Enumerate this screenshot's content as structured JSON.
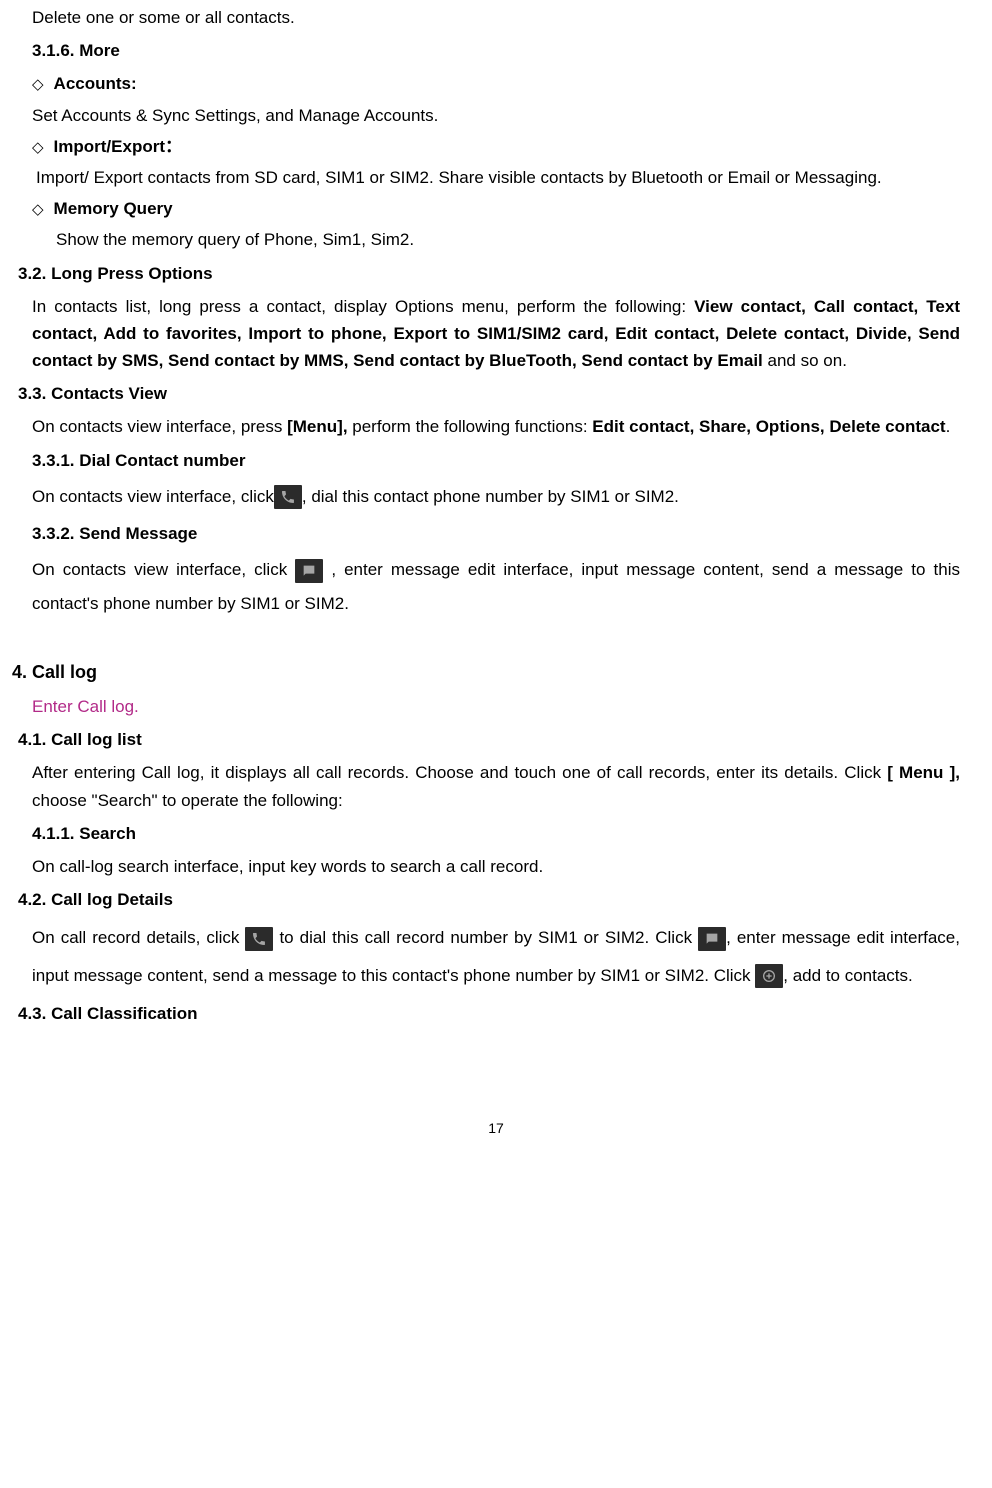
{
  "page": {
    "number": "17"
  },
  "s1": {
    "delete_text": "Delete one or some or all contacts.",
    "h316": "3.1.6.  More",
    "accounts_label": "Accounts:",
    "accounts_body": "Set Accounts & Sync Settings, and Manage Accounts.",
    "impexp_label": "Import/Export：",
    "impexp_body": "Import/ Export contacts from SD card, SIM1 or SIM2. Share visible contacts by Bluetooth or Email or Messaging.",
    "memq_label": "Memory Query",
    "memq_body": "Show the memory query of Phone, Sim1, Sim2."
  },
  "s32": {
    "heading": "3.2.   Long Press Options",
    "body_pre": "In contacts list, long press a contact, display Options menu, perform the following: ",
    "body_bold": "View contact, Call contact, Text contact, Add to favorites, Import to phone, Export to SIM1/SIM2 card, Edit contact, Delete contact, Divide, Send contact by SMS, Send contact by MMS, Send contact by BlueTooth, Send contact by Email",
    "body_post": " and so on."
  },
  "s33": {
    "heading": "3.3.   Contacts View",
    "body_pre": "On contacts view interface, press ",
    "body_menu": "[Menu],",
    "body_mid": " perform the following functions: ",
    "body_bold": "Edit contact, Share, Options, Delete contact",
    "body_post": ".",
    "h331": "3.3.1.  Dial Contact number",
    "s331_pre": "On contacts view interface, click",
    "s331_post": ", dial this contact phone number by SIM1 or SIM2.",
    "h332": "3.3.2.  Send Message",
    "s332_pre": "On contacts view interface, click ",
    "s332_mid": " , enter message edit interface, input message content, send a message to this contact's phone number by SIM1 or SIM2."
  },
  "s4": {
    "heading": "4.    Call log",
    "enter": "Enter Call log.",
    "h41": "4.1.   Call log list",
    "body41_pre": "After entering Call log, it displays all call records. Choose and touch one of call records, enter its details. Click ",
    "body41_menu": "[ Menu ],",
    "body41_post": " choose \"Search\" to operate the following:",
    "h411": "4.1.1.  Search",
    "body411": "On call-log search interface, input key words to search a call record.",
    "h42": "4.2.   Call log Details",
    "s42_pre": "On call record details, click ",
    "s42_mid1": " to dial this call record number by SIM1 or SIM2. Click ",
    "s42_mid2": ", enter message edit interface, input message content, send a message to this contact's phone number by SIM1 or SIM2. Click ",
    "s42_post": ", add to contacts.",
    "h43": "4.3.   Call Classification"
  }
}
